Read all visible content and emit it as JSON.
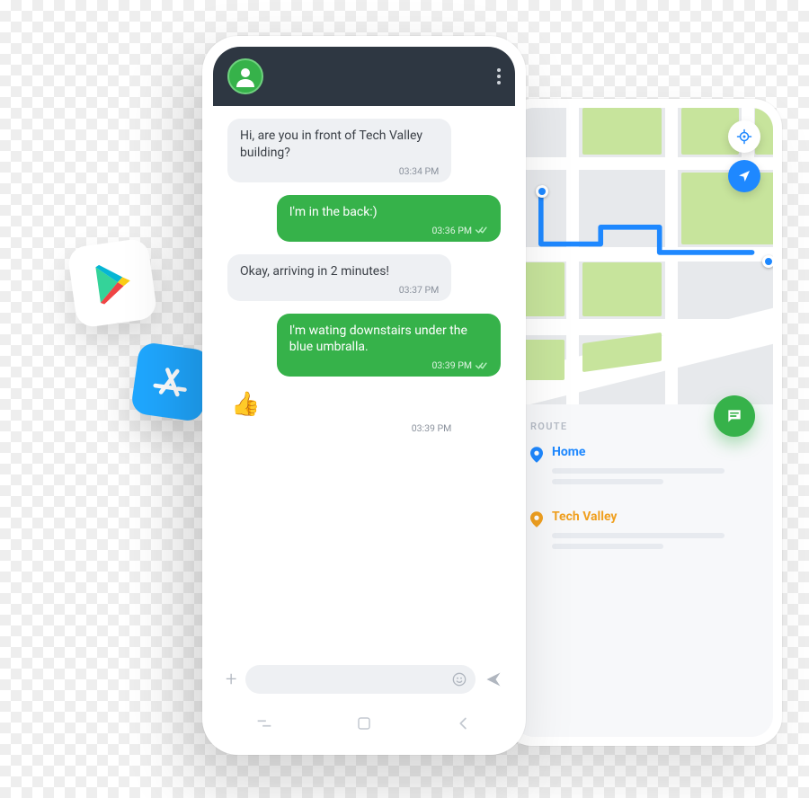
{
  "chat": {
    "messages": [
      {
        "dir": "in",
        "text": "Hi, are you in front of Tech Valley building?",
        "time": "03:34 PM"
      },
      {
        "dir": "out",
        "text": "I'm in the back:)",
        "time": "03:36 PM"
      },
      {
        "dir": "in",
        "text": "Okay, arriving in 2 minutes!",
        "time": "03:37 PM"
      },
      {
        "dir": "out",
        "text": "I'm wating downstairs under the blue umbralla.",
        "time": "03:39 PM"
      },
      {
        "dir": "in",
        "emoji": "👍",
        "time": "03:39 PM"
      }
    ]
  },
  "route": {
    "section_title": "ROUTE",
    "stops": [
      {
        "kind": "home",
        "label": "Home"
      },
      {
        "kind": "dest",
        "label": "Tech Valley"
      }
    ]
  }
}
